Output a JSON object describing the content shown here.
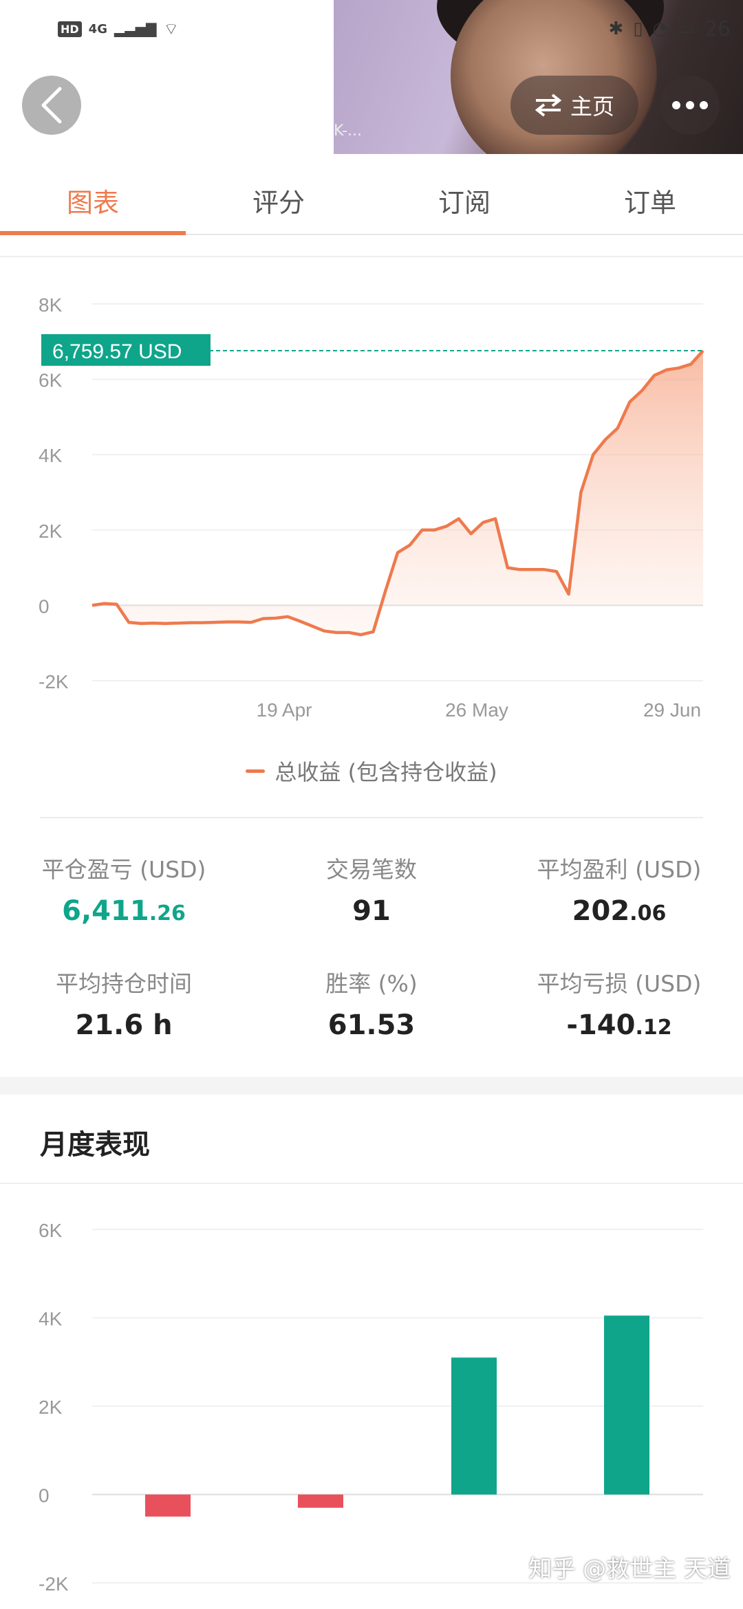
{
  "status_bar": {
    "hd": "HD",
    "network": "4G",
    "clock_partial": "26"
  },
  "video": {
    "caption": "K-..."
  },
  "header": {
    "back_icon": "chevron-left-icon",
    "home_label": "主页",
    "home_icon": "swap-arrows-icon",
    "more_icon": "more-dots-icon"
  },
  "tabs": [
    {
      "label": "图表",
      "active": true
    },
    {
      "label": "评分",
      "active": false
    },
    {
      "label": "订阅",
      "active": false
    },
    {
      "label": "订单",
      "active": false
    }
  ],
  "colors": {
    "accent": "#ee7a4d",
    "profit": "#0fa58a",
    "loss": "#e8505b"
  },
  "chart_data": [
    {
      "type": "area",
      "current_value_label": "6,759.57 USD",
      "current_value": 6759.57,
      "yticks": [
        "8K",
        "6K",
        "4K",
        "2K",
        "0",
        "-2K"
      ],
      "ylim": [
        -2000,
        8000
      ],
      "xticks": [
        "19 Apr",
        "26 May",
        "29 Jun"
      ],
      "legend": "总收益 (包含持仓收益)",
      "grid": true,
      "series": [
        {
          "name": "总收益 (包含持仓收益)",
          "values": [
            0,
            50,
            30,
            -450,
            -480,
            -470,
            -480,
            -470,
            -460,
            -460,
            -450,
            -440,
            -440,
            -450,
            -350,
            -340,
            -300,
            -420,
            -550,
            -680,
            -720,
            -720,
            -780,
            -700,
            380,
            1400,
            1600,
            2000,
            2000,
            2100,
            2300,
            1900,
            2200,
            2300,
            1000,
            950,
            950,
            950,
            900,
            300,
            3000,
            4000,
            4400,
            4700,
            5400,
            5700,
            6100,
            6250,
            6300,
            6400,
            6759.57
          ]
        }
      ]
    },
    {
      "type": "bar",
      "title": "月度表现",
      "yticks": [
        "6K",
        "4K",
        "2K",
        "0",
        "-2K"
      ],
      "ylim": [
        -2000,
        6000
      ],
      "grid": true,
      "values": [
        -500,
        -300,
        3100,
        4050
      ]
    }
  ],
  "stats": [
    {
      "label": "平仓盈亏 (USD)",
      "int": "6,411",
      "frac": ".26",
      "color": "green"
    },
    {
      "label": "交易笔数",
      "int": "91",
      "frac": "",
      "color": "default"
    },
    {
      "label": "平均盈利 (USD)",
      "int": "202",
      "frac": ".06",
      "color": "default"
    },
    {
      "label": "平均持仓时间",
      "int": "21.6 h",
      "frac": "",
      "color": "default"
    },
    {
      "label": "胜率 (%)",
      "int": "61.53",
      "frac": "",
      "color": "default"
    },
    {
      "label": "平均亏损 (USD)",
      "int": "-140",
      "frac": ".12",
      "color": "default"
    }
  ],
  "monthly": {
    "title": "月度表现"
  },
  "watermark": "知乎 @救世主 天道"
}
